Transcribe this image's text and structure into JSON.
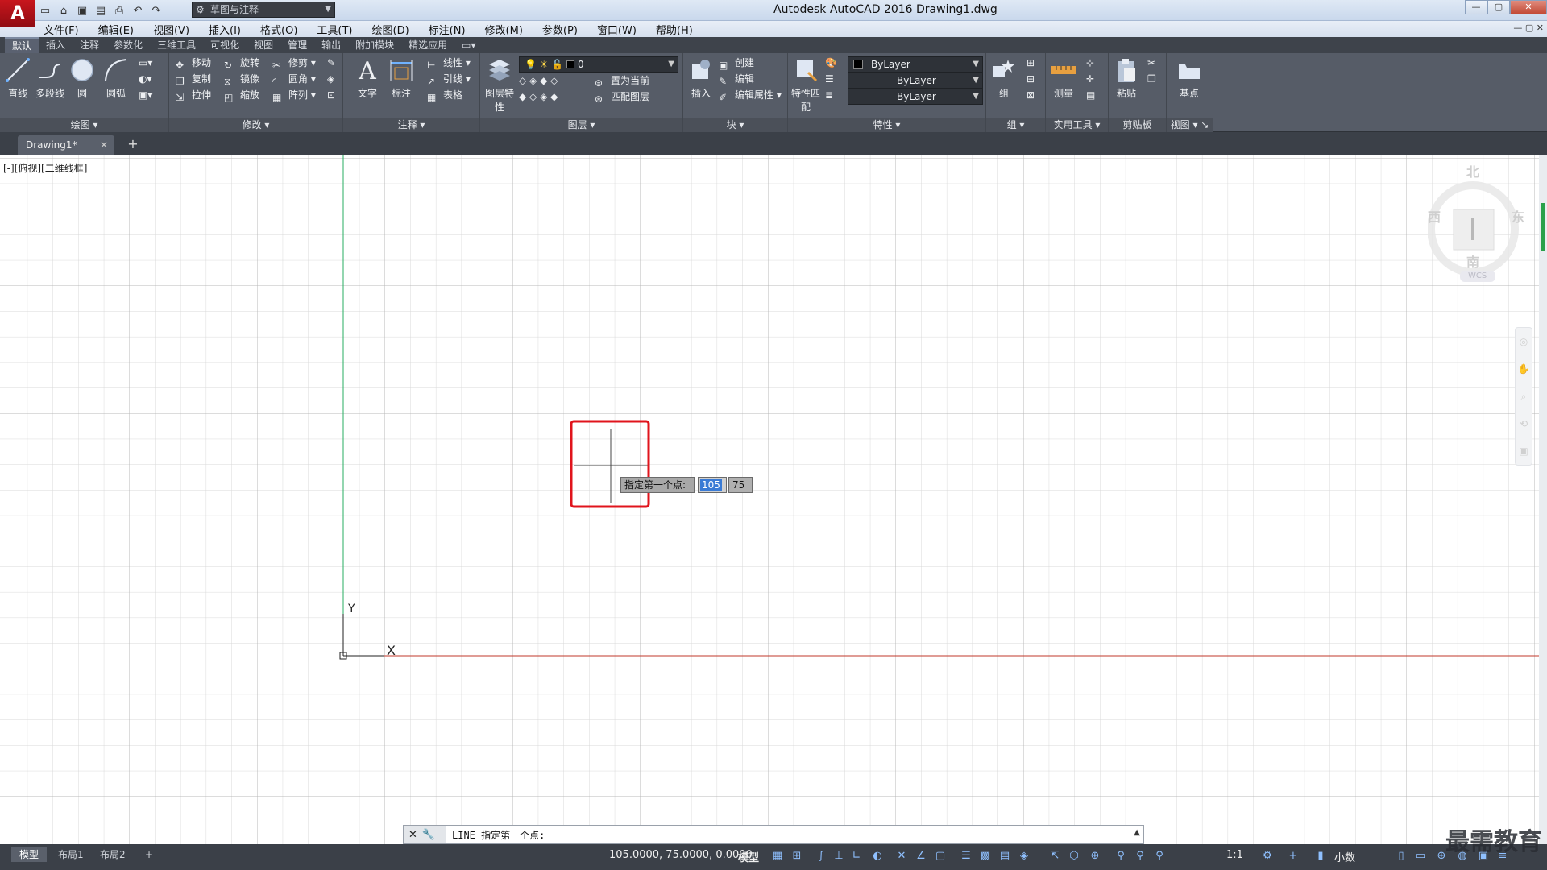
{
  "app": {
    "title": "Autodesk AutoCAD 2016    Drawing1.dwg",
    "logo_letter": "A",
    "workspace": "草图与注释"
  },
  "menu": [
    "文件(F)",
    "编辑(E)",
    "视图(V)",
    "插入(I)",
    "格式(O)",
    "工具(T)",
    "绘图(D)",
    "标注(N)",
    "修改(M)",
    "参数(P)",
    "窗口(W)",
    "帮助(H)"
  ],
  "ribbon_tabs": [
    "默认",
    "插入",
    "注释",
    "参数化",
    "三维工具",
    "可视化",
    "视图",
    "管理",
    "输出",
    "附加模块",
    "精选应用"
  ],
  "ribbon": {
    "draw": {
      "title": "绘图",
      "line": "直线",
      "polyline": "多段线",
      "circle": "圆",
      "arc": "圆弧"
    },
    "modify": {
      "title": "修改",
      "move": "移动",
      "rotate": "旋转",
      "trim": "修剪",
      "copy": "复制",
      "mirror": "镜像",
      "fillet": "圆角",
      "stretch": "拉伸",
      "scale": "缩放",
      "array": "阵列"
    },
    "annotation": {
      "title": "注释",
      "text": "文字",
      "dimension": "标注",
      "linear": "线性",
      "leader": "引线",
      "table": "表格"
    },
    "layers": {
      "title": "图层",
      "properties": "图层特性",
      "current_layer": "0",
      "make_current": "置为当前",
      "match": "匹配图层"
    },
    "block": {
      "title": "块",
      "insert": "插入",
      "create": "创建",
      "edit": "编辑",
      "edit_attr": "编辑属性"
    },
    "properties": {
      "title": "特性",
      "match": "特性匹配",
      "color": "ByLayer",
      "linetype": "ByLayer",
      "lineweight": "ByLayer"
    },
    "groups": {
      "title": "组",
      "group": "组"
    },
    "utilities": {
      "title": "实用工具",
      "measure": "测量"
    },
    "clipboard": {
      "title": "剪贴板",
      "paste": "粘贴"
    },
    "view": {
      "title": "视图",
      "basepoint": "基点"
    }
  },
  "doc_tab": "Drawing1*",
  "viewport_label": "[-][俯视][二维线框]",
  "viewcube": {
    "north": "北",
    "south": "南",
    "east": "东",
    "west": "西",
    "wcs": "WCS"
  },
  "ucs": {
    "x": "X",
    "y": "Y"
  },
  "dynamic_input": {
    "prompt": "指定第一个点:",
    "x_value": "105",
    "y_value": "75"
  },
  "command_line": {
    "text": "LINE 指定第一个点:"
  },
  "layout_tabs": [
    "模型",
    "布局1",
    "布局2"
  ],
  "status": {
    "coords": "105.0000, 75.0000, 0.0000",
    "model": "模型",
    "scale": "1:1",
    "units": "小数"
  },
  "watermark": "最需教育",
  "colors": {
    "highlight_box": "#e0141c",
    "x_axis": "#c0392b",
    "y_axis": "#27ae60",
    "grid": "#d9d9d9",
    "grid_major": "#b8b8b8"
  }
}
